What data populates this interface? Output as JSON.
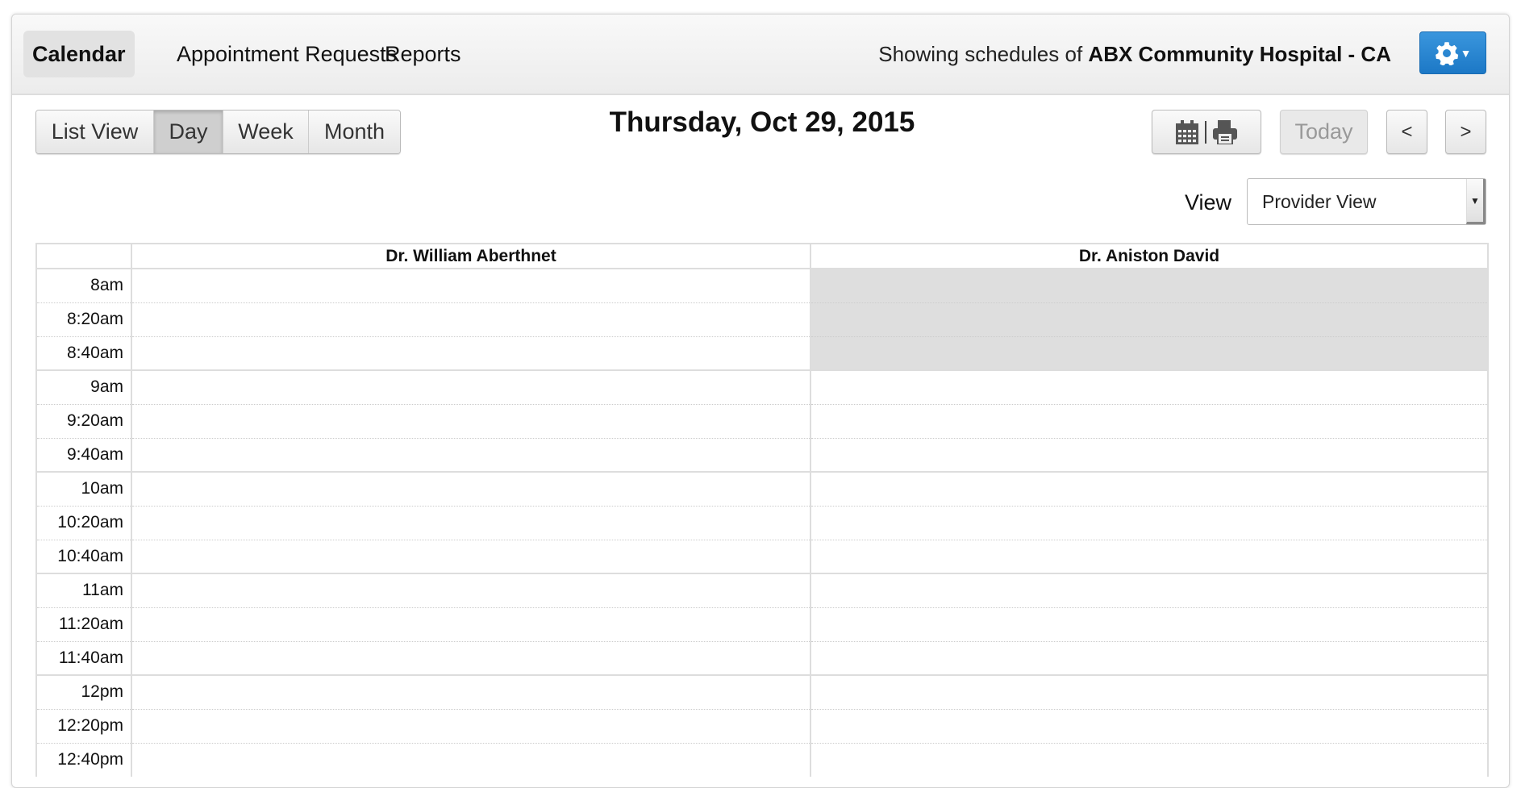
{
  "nav": {
    "tabs": [
      "Calendar",
      "Appointment Requests",
      "Reports"
    ],
    "active": "Calendar"
  },
  "header": {
    "showing_prefix": "Showing schedules of",
    "facility": "ABX Community Hospital - CA",
    "settings_icon": "gear-icon"
  },
  "toolbar": {
    "views": [
      "List View",
      "Day",
      "Week",
      "Month"
    ],
    "active_view": "Day",
    "date_title": "Thursday, Oct 29, 2015",
    "today_label": "Today",
    "prev_label": "<",
    "next_label": ">",
    "view_label": "View",
    "view_select": "Provider View"
  },
  "calendar": {
    "providers": [
      "Dr. William Aberthnet",
      "Dr. Aniston David"
    ],
    "slots": [
      "8am",
      "8:20am",
      "8:40am",
      "9am",
      "9:20am",
      "9:40am",
      "10am",
      "10:20am",
      "10:40am",
      "11am",
      "11:20am",
      "11:40am",
      "12pm",
      "12:20pm",
      "12:40pm"
    ],
    "unavailable": {
      "Dr. Aniston David": [
        "8am",
        "8:20am",
        "8:40am"
      ]
    }
  },
  "colors": {
    "accent": "#2a86d2",
    "unavailable": "#dedede"
  }
}
